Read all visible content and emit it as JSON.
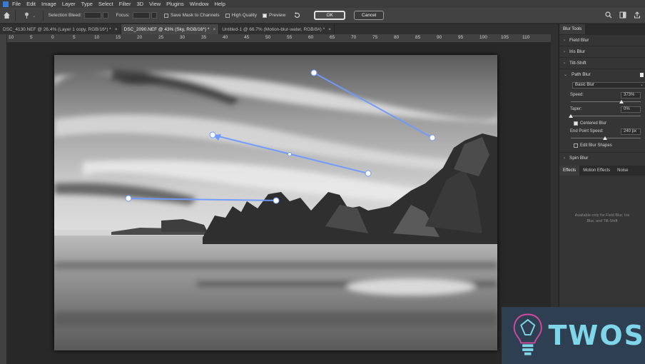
{
  "menu": [
    "File",
    "Edit",
    "Image",
    "Layer",
    "Type",
    "Select",
    "Filter",
    "3D",
    "View",
    "Plugins",
    "Window",
    "Help"
  ],
  "options": {
    "selection_bleed_label": "Selection Bleed:",
    "focus_label": "Focus:",
    "save_mask_label": "Save Mask to Channels",
    "high_quality_label": "High Quality",
    "preview_label": "Preview",
    "ok_label": "OK",
    "cancel_label": "Cancel"
  },
  "tabs": [
    {
      "label": "DSC_4130.NEF @ 26.4% (Layer 1 copy, RGB/16*) *",
      "active": false
    },
    {
      "label": "DSC_2090.NEF @ 43% (Sky, RGB/16*) *",
      "active": true
    },
    {
      "label": "Untitled-1 @ 66.7% (Motion-blur-water, RGB/8#) *",
      "active": false
    }
  ],
  "ruler_ticks": [
    "10",
    "5",
    "0",
    "5",
    "10",
    "15",
    "20",
    "25",
    "30",
    "35",
    "40",
    "45",
    "50",
    "55",
    "60",
    "65",
    "70",
    "75",
    "80",
    "85",
    "90",
    "95",
    "100",
    "105",
    "110"
  ],
  "panel": {
    "title": "Blur Tools",
    "field_blur": "Field Blur",
    "iris_blur": "Iris Blur",
    "tilt_shift": "Tilt-Shift",
    "path_blur": "Path Blur",
    "blur_type": "Basic Blur",
    "speed_label": "Speed:",
    "speed_value": "373%",
    "speed_fraction": 0.75,
    "taper_label": "Taper:",
    "taper_value": "0%",
    "taper_fraction": 0.0,
    "centered_blur_label": "Centered Blur",
    "end_point_speed_label": "End Point Speed:",
    "end_point_speed_value": "240 px",
    "end_point_fraction": 0.5,
    "edit_blur_shapes_label": "Edit Blur Shapes",
    "spin_blur": "Spin Blur",
    "effects_tabs": [
      "Effects",
      "Motion Effects",
      "Noise"
    ],
    "effects_note": "Available only for Field Blur, Iris Blur, and Tilt-Shift"
  },
  "watermark": {
    "text": "TWOS"
  },
  "colors": {
    "accent": "#6e9bff",
    "panel": "#353535",
    "watermark_bg": "#2f3f52",
    "watermark_text": "#7fd6e8"
  }
}
